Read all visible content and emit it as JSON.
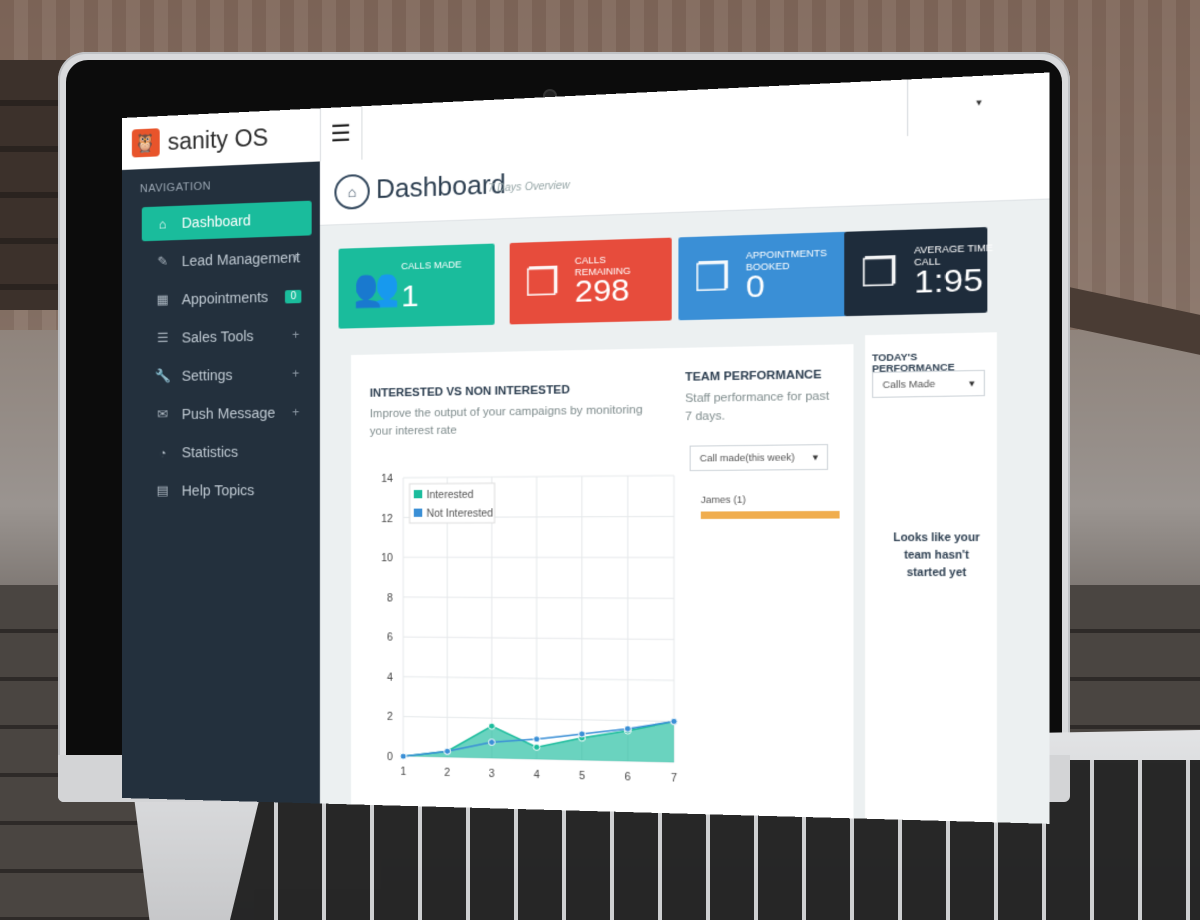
{
  "app": {
    "name": "sanity OS",
    "menu_icon": "☰"
  },
  "sidebar": {
    "title": "NAVIGATION",
    "items": [
      {
        "label": "Dashboard",
        "icon": "home-icon",
        "active": true
      },
      {
        "label": "Lead Management",
        "icon": "edit-icon",
        "expand": "+"
      },
      {
        "label": "Appointments",
        "icon": "calendar-icon",
        "badge": "0"
      },
      {
        "label": "Sales Tools",
        "icon": "list-icon",
        "expand": "+"
      },
      {
        "label": "Settings",
        "icon": "wrench-icon",
        "expand": "+"
      },
      {
        "label": "Push Message",
        "icon": "envelope-icon",
        "expand": "+"
      },
      {
        "label": "Statistics",
        "icon": "dashboard-icon"
      },
      {
        "label": "Help Topics",
        "icon": "book-icon"
      }
    ]
  },
  "header": {
    "title": "Dashboard",
    "subtitle": "7 Days Overview"
  },
  "stats": [
    {
      "label": "CALLS MADE",
      "value": "1",
      "color": "#1abc9c",
      "icon": "users-icon"
    },
    {
      "label": "CALLS REMAINING",
      "value": "298",
      "color": "#e74c3c",
      "icon": "files-icon"
    },
    {
      "label": "APPOINTMENTS BOOKED",
      "value": "0",
      "color": "#3a8fd6",
      "icon": "files-icon"
    },
    {
      "label": "AVERAGE TIME CALL",
      "value": "1:95",
      "color": "#1e2c3b",
      "icon": "files-icon"
    }
  ],
  "interest_panel": {
    "title": "INTERESTED VS NON INTERESTED",
    "description": "Improve the output of your campaigns by monitoring your interest rate"
  },
  "team_panel": {
    "title": "TEAM PERFORMANCE",
    "description": "Staff performance for past 7 days.",
    "select_value": "Call made(this week)",
    "member_label": "James (1)",
    "member_progress": 1.0
  },
  "today_panel": {
    "title": "TODAY'S PERFORMANCE",
    "select_value": "Calls Made",
    "empty_message": "Looks like your team hasn't started yet"
  },
  "chart_data": {
    "type": "area",
    "x": [
      1,
      2,
      3,
      4,
      5,
      6,
      7
    ],
    "series": [
      {
        "name": "Interested",
        "values": [
          0,
          0.3,
          1.6,
          0.6,
          1.1,
          1.5,
          2
        ],
        "color": "#1abc9c"
      },
      {
        "name": "Not Interested",
        "values": [
          0,
          0.3,
          0.8,
          1.0,
          1.3,
          1.6,
          2
        ],
        "color": "#3a8fd6"
      }
    ],
    "yticks": [
      0,
      2,
      4,
      6,
      8,
      10,
      12,
      14
    ],
    "ylim": [
      0,
      14
    ],
    "grid": true,
    "legend": "top-left"
  }
}
